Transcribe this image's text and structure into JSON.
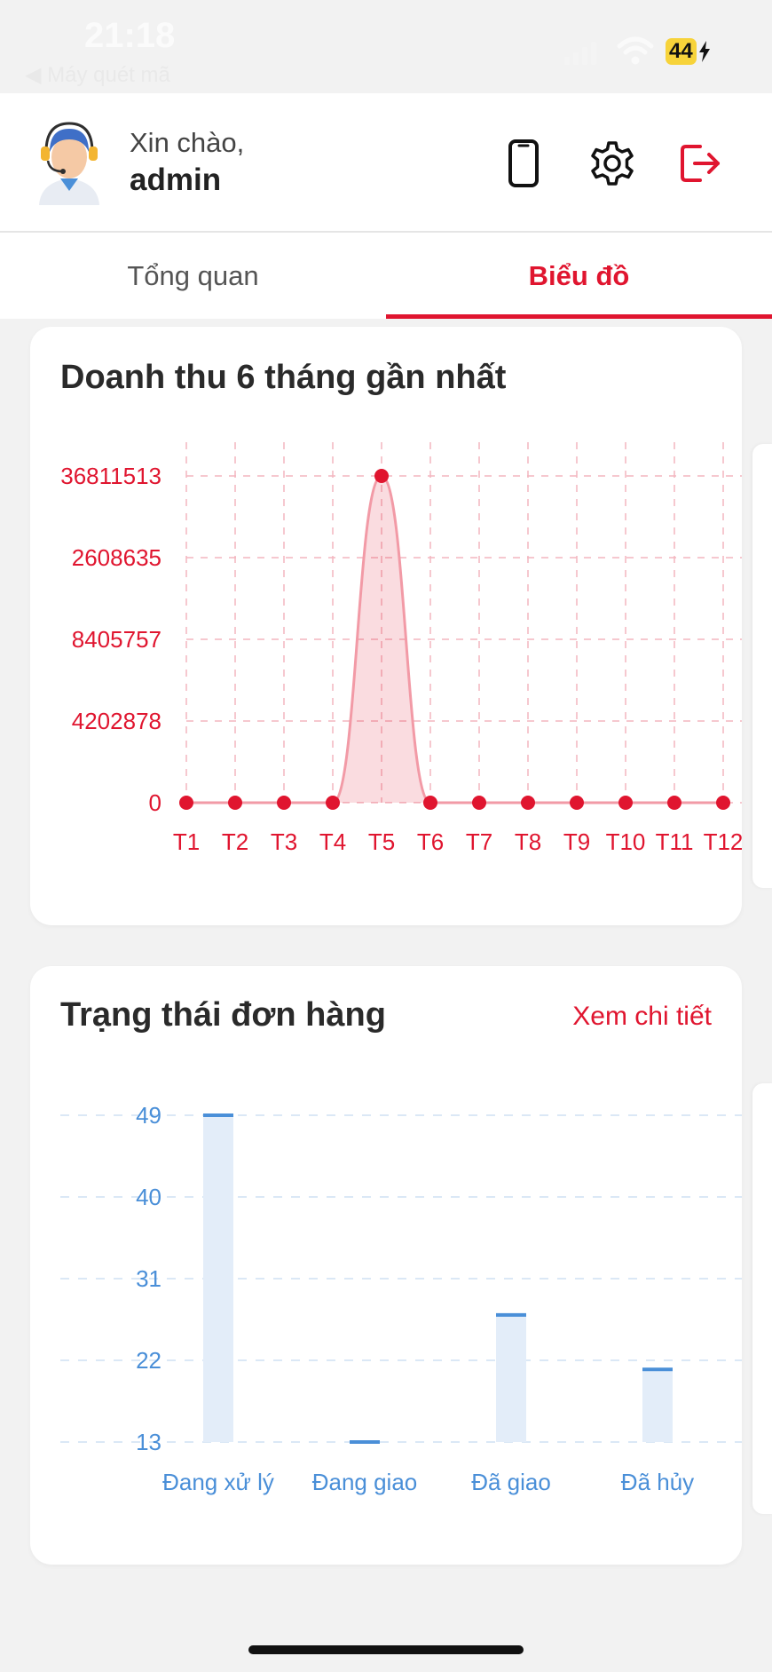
{
  "status_bar": {
    "time": "21:18",
    "back_label": "◀ Máy quét mã",
    "battery": "44"
  },
  "header": {
    "greeting": "Xin chào,",
    "username": "admin",
    "icons": [
      "phone-icon",
      "gear-icon",
      "logout-icon"
    ],
    "accent_color": "#e0152f"
  },
  "tabs": [
    {
      "label": "Tổng quan",
      "active": false
    },
    {
      "label": "Biểu đồ",
      "active": true
    }
  ],
  "revenue_card": {
    "title": "Doanh thu 6 tháng gần nhất"
  },
  "status_card": {
    "title": "Trạng thái đơn hàng",
    "detail_link": "Xem chi tiết"
  },
  "chart_data": [
    {
      "type": "area",
      "title": "Doanh thu 6 tháng gần nhất",
      "categories": [
        "T1",
        "T2",
        "T3",
        "T4",
        "T5",
        "T6",
        "T7",
        "T8",
        "T9",
        "T10",
        "T11",
        "T12"
      ],
      "values": [
        0,
        0,
        0,
        0,
        16811513,
        0,
        0,
        0,
        0,
        0,
        0,
        0
      ],
      "y_ticks": [
        "36811513",
        "2608635",
        "8405757",
        "4202878",
        "0"
      ],
      "ylim": [
        0,
        16811513
      ],
      "grid": true,
      "color": "#e0152f"
    },
    {
      "type": "bar",
      "title": "Trạng thái đơn hàng",
      "categories": [
        "Đang xử lý",
        "Đang giao",
        "Đã giao",
        "Đã hủy"
      ],
      "values": [
        49,
        13,
        27,
        21
      ],
      "y_ticks": [
        "49",
        "40",
        "31",
        "22",
        "13"
      ],
      "ylim": [
        13,
        49
      ],
      "grid": true,
      "color": "#4a8fd8"
    }
  ]
}
